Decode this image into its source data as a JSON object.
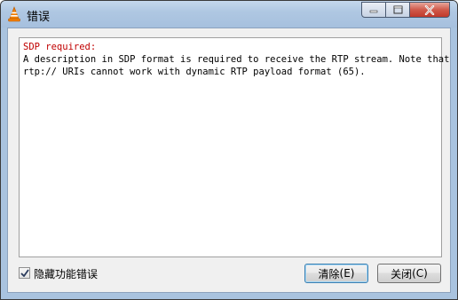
{
  "window": {
    "title": "错误",
    "icon": "vlc-cone-icon"
  },
  "message": {
    "heading": "SDP required:",
    "line1": "A description in SDP format is required to receive the RTP stream. Note that",
    "line2": "rtp:// URIs cannot work with dynamic RTP payload format (65)."
  },
  "footer": {
    "checkbox_label": "隐藏功能错误",
    "checkbox_checked": true,
    "clear_button": {
      "text": "清除",
      "shortcut": "(E)"
    },
    "close_button": {
      "text": "关闭",
      "shortcut": "(C)"
    }
  },
  "colors": {
    "heading": "#c00000",
    "titlebar": "#afc7e2",
    "close_button": "#c0392b"
  }
}
